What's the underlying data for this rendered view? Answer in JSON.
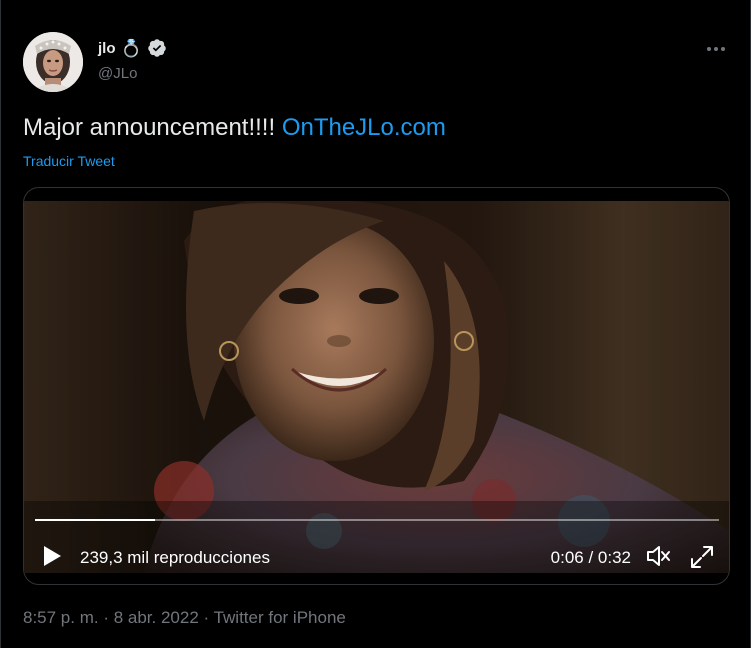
{
  "author": {
    "display_name": "jlo",
    "emoji": "💍",
    "handle": "@JLo",
    "verified": true,
    "avatar_icon": "avatar-photo-icon"
  },
  "more_icon": "more-options-icon",
  "tweet": {
    "text": "Major announcement!!!! ",
    "link_text": "OnTheJLo.com",
    "translate_label": "Traducir Tweet"
  },
  "video": {
    "views": "239,3 mil reproducciones",
    "time": "0:06 / 0:32",
    "progress_fraction": 0.175,
    "play_icon": "play-icon",
    "volume_icon": "volume-muted-icon",
    "fullscreen_icon": "fullscreen-icon"
  },
  "meta": {
    "text": "8:57 p. m. · 8 abr. 2022 · Twitter for iPhone"
  },
  "colors": {
    "background": "#000000",
    "text": "#e7e9ea",
    "secondary": "#71767b",
    "accent": "#1d9bf0"
  }
}
